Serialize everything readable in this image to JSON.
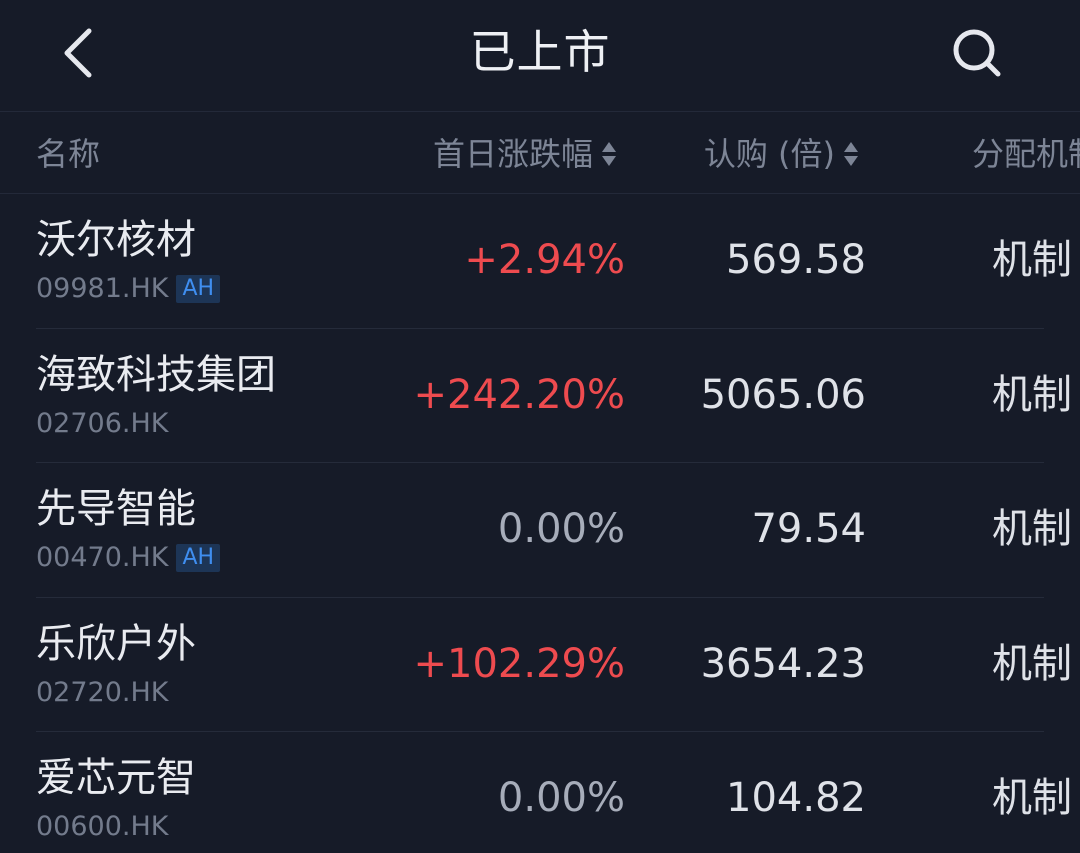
{
  "header": {
    "title": "已上市",
    "back_icon": "chevron-left-icon",
    "search_icon": "search-icon"
  },
  "columns": {
    "name": "名称",
    "first_day_change": "首日涨跌幅",
    "subscription": "认购 (倍)",
    "allocation": "分配机制"
  },
  "colors": {
    "up": "#ee4b4f",
    "flat": "#a7adba",
    "badge_text": "#3f8ef0",
    "background": "#161b28"
  },
  "rows": [
    {
      "name": "沃尔核材",
      "code": "09981.HK",
      "badge": "AH",
      "change": "+2.94%",
      "direction": "up",
      "subscription": "569.58",
      "allocation": "机制"
    },
    {
      "name": "海致科技集团",
      "code": "02706.HK",
      "badge": "",
      "change": "+242.20%",
      "direction": "up",
      "subscription": "5065.06",
      "allocation": "机制"
    },
    {
      "name": "先导智能",
      "code": "00470.HK",
      "badge": "AH",
      "change": "0.00%",
      "direction": "flat",
      "subscription": "79.54",
      "allocation": "机制"
    },
    {
      "name": "乐欣户外",
      "code": "02720.HK",
      "badge": "",
      "change": "+102.29%",
      "direction": "up",
      "subscription": "3654.23",
      "allocation": "机制"
    },
    {
      "name": "爱芯元智",
      "code": "00600.HK",
      "badge": "",
      "change": "0.00%",
      "direction": "flat",
      "subscription": "104.82",
      "allocation": "机制"
    }
  ]
}
